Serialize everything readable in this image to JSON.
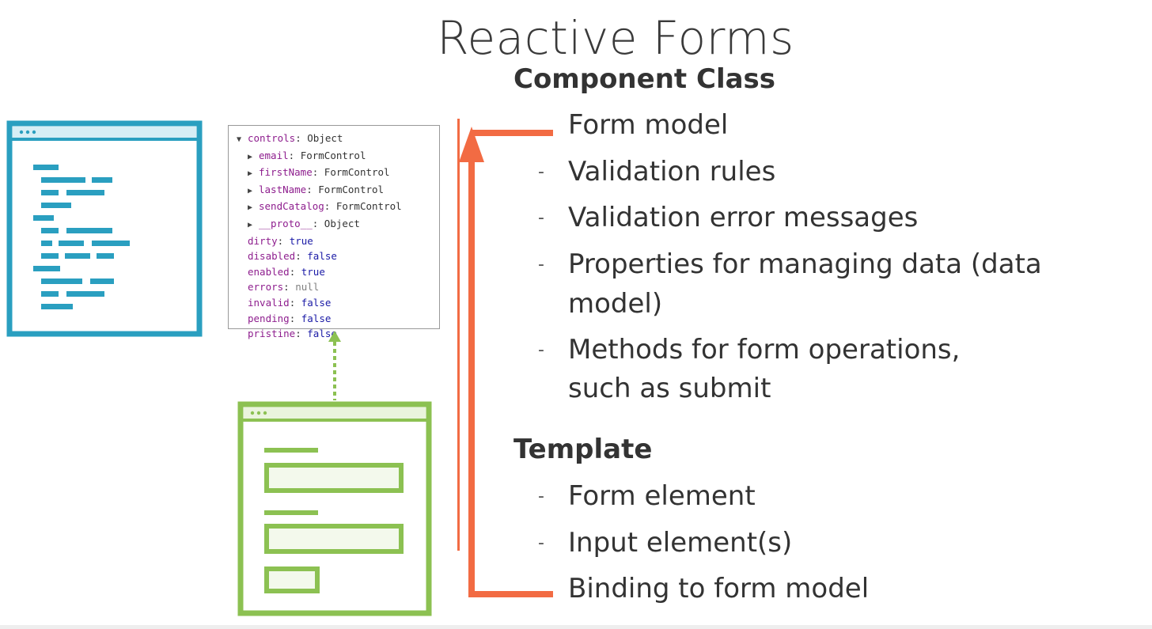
{
  "slide": {
    "title": "Reactive Forms",
    "component_heading": "Component Class",
    "component_items": [
      {
        "text": "Form model",
        "marker": ""
      },
      {
        "text": "Validation rules",
        "marker": "-"
      },
      {
        "text": "Validation error messages",
        "marker": "-"
      },
      {
        "text": "Properties for managing data (data",
        "marker": "-"
      },
      {
        "text": "model)",
        "marker": ""
      },
      {
        "text": "Methods for form operations,",
        "marker": "-"
      },
      {
        "text": "such as submit",
        "marker": ""
      }
    ],
    "template_heading": "Template",
    "template_items": [
      {
        "text": "Form element",
        "marker": "-"
      },
      {
        "text": "Input element(s)",
        "marker": "-"
      },
      {
        "text": "Binding to form model",
        "marker": ""
      }
    ]
  },
  "code_panel": {
    "lines": [
      {
        "tri": "▼",
        "key": "controls",
        "sep": ": ",
        "val": "Object",
        "indent": 0,
        "key_class": "k",
        "val_class": ""
      },
      {
        "tri": "▶",
        "key": "email",
        "sep": ": ",
        "val": "FormControl",
        "indent": 1,
        "key_class": "k",
        "val_class": ""
      },
      {
        "tri": "▶",
        "key": "firstName",
        "sep": ": ",
        "val": "FormControl",
        "indent": 1,
        "key_class": "k",
        "val_class": ""
      },
      {
        "tri": "▶",
        "key": "lastName",
        "sep": ": ",
        "val": "FormControl",
        "indent": 1,
        "key_class": "k",
        "val_class": ""
      },
      {
        "tri": "▶",
        "key": "sendCatalog",
        "sep": ": ",
        "val": "FormControl",
        "indent": 1,
        "key_class": "k",
        "val_class": ""
      },
      {
        "tri": "▶",
        "key": "__proto__",
        "sep": ": ",
        "val": "Object",
        "indent": 1,
        "key_class": "k",
        "val_class": ""
      },
      {
        "tri": "",
        "key": "dirty",
        "sep": ": ",
        "val": "true",
        "indent": 0,
        "key_class": "k",
        "val_class": "v"
      },
      {
        "tri": "",
        "key": "disabled",
        "sep": ": ",
        "val": "false",
        "indent": 0,
        "key_class": "k",
        "val_class": "v"
      },
      {
        "tri": "",
        "key": "enabled",
        "sep": ": ",
        "val": "true",
        "indent": 0,
        "key_class": "k",
        "val_class": "v"
      },
      {
        "tri": "",
        "key": "errors",
        "sep": ": ",
        "val": "null",
        "indent": 0,
        "key_class": "k",
        "val_class": "n"
      },
      {
        "tri": "",
        "key": "invalid",
        "sep": ": ",
        "val": "false",
        "indent": 0,
        "key_class": "k",
        "val_class": "v"
      },
      {
        "tri": "",
        "key": "pending",
        "sep": ": ",
        "val": "false",
        "indent": 0,
        "key_class": "k",
        "val_class": "v"
      },
      {
        "tri": "",
        "key": "pristine",
        "sep": ": ",
        "val": "false",
        "indent": 0,
        "key_class": "k",
        "val_class": "v"
      }
    ]
  },
  "colors": {
    "code_icon": "#2a9fc0",
    "form_icon": "#8cc152",
    "arrow": "#f26b43",
    "dotted_arrow": "#8cc152"
  },
  "icons": {
    "code_window": "code-window-icon",
    "form_window": "form-window-icon"
  }
}
